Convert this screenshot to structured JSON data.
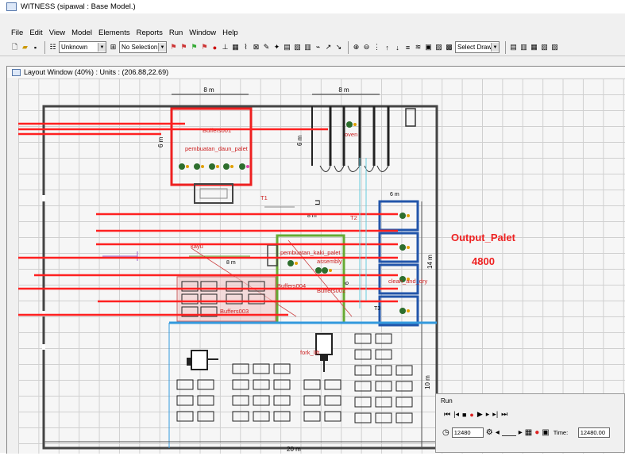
{
  "window": {
    "title": "WITNESS (sipawal : Base Model.)"
  },
  "menu": [
    "File",
    "Edit",
    "View",
    "Model",
    "Elements",
    "Reports",
    "Run",
    "Window",
    "Help"
  ],
  "toolbar": {
    "combo_unknown": "Unknown",
    "combo_selection": "No Selection",
    "combo_drawing": "Select Drawing"
  },
  "layout_window": {
    "title": "Layout Window (40%) : Units : (206.88,22.69)"
  },
  "model": {
    "dim_8m_left": "8 m",
    "dim_8m_right": "8 m",
    "dim_6m_left": "6 m",
    "dim_6m_right": "6 m",
    "dim_6m_small": "6 m",
    "dim_8m_mid": "8 m",
    "dim_8m_lower": "8 m",
    "dim_14m": "14 m",
    "dim_10m": "10 m",
    "dim_20m": "20 m",
    "dim_6_vert": "6",
    "buffers001": "Buffers001",
    "pembuatan_daun_palet": "pembuatan_daun_palet",
    "oven": "oven",
    "t1": "T1",
    "t2": "T2",
    "t3": "T3",
    "kayu": "kayu",
    "pembuatan_kaki_palet": "pembuatan_kaki_palet",
    "assembly": "assembly",
    "buffers004": "Buffers004",
    "buffers002": "Buffers002",
    "buffers003": "Buffers003",
    "clean_and_dry": "clean_and_dry",
    "fork_lift": "fork_lift",
    "output_palet_label": "Output_Palet",
    "output_palet_value": "4800"
  },
  "run_window": {
    "title": "Run",
    "step_value": "12480",
    "time_label": "Time:",
    "time_value": "12480.00"
  },
  "colors": {
    "red_line": "#ff2020",
    "output_text": "#ee2222",
    "green_box": "#66aa33",
    "blue_box": "#2255aa"
  }
}
